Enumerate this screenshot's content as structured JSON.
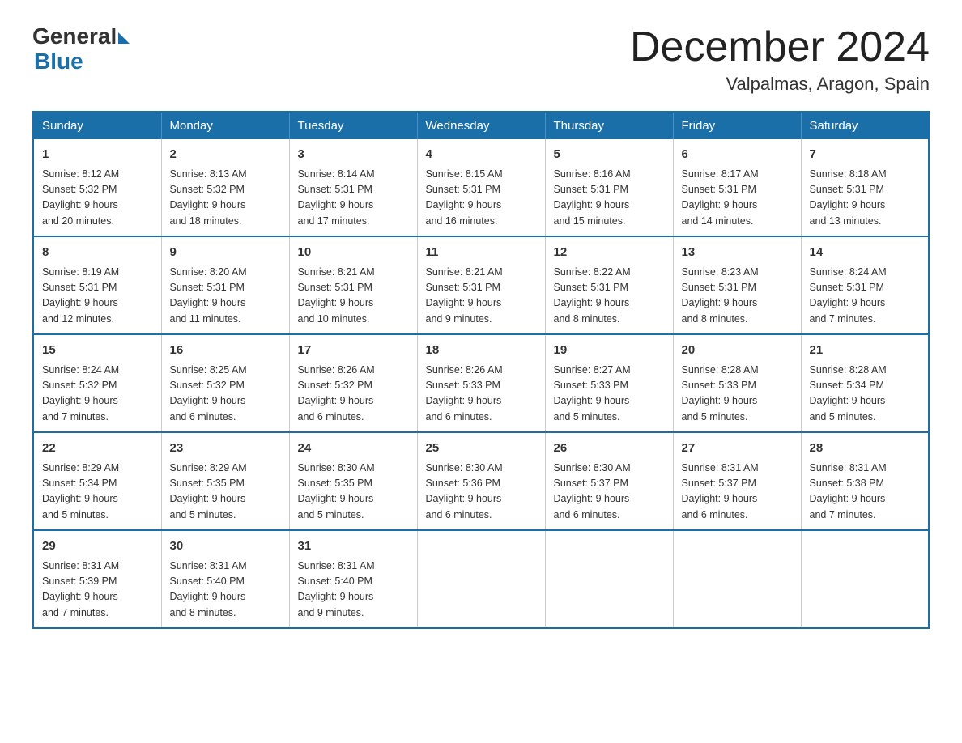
{
  "header": {
    "logo_general": "General",
    "logo_blue": "Blue",
    "month_title": "December 2024",
    "location": "Valpalmas, Aragon, Spain"
  },
  "weekdays": [
    "Sunday",
    "Monday",
    "Tuesday",
    "Wednesday",
    "Thursday",
    "Friday",
    "Saturday"
  ],
  "weeks": [
    [
      {
        "day": "1",
        "sunrise": "8:12 AM",
        "sunset": "5:32 PM",
        "daylight": "9 hours and 20 minutes."
      },
      {
        "day": "2",
        "sunrise": "8:13 AM",
        "sunset": "5:32 PM",
        "daylight": "9 hours and 18 minutes."
      },
      {
        "day": "3",
        "sunrise": "8:14 AM",
        "sunset": "5:31 PM",
        "daylight": "9 hours and 17 minutes."
      },
      {
        "day": "4",
        "sunrise": "8:15 AM",
        "sunset": "5:31 PM",
        "daylight": "9 hours and 16 minutes."
      },
      {
        "day": "5",
        "sunrise": "8:16 AM",
        "sunset": "5:31 PM",
        "daylight": "9 hours and 15 minutes."
      },
      {
        "day": "6",
        "sunrise": "8:17 AM",
        "sunset": "5:31 PM",
        "daylight": "9 hours and 14 minutes."
      },
      {
        "day": "7",
        "sunrise": "8:18 AM",
        "sunset": "5:31 PM",
        "daylight": "9 hours and 13 minutes."
      }
    ],
    [
      {
        "day": "8",
        "sunrise": "8:19 AM",
        "sunset": "5:31 PM",
        "daylight": "9 hours and 12 minutes."
      },
      {
        "day": "9",
        "sunrise": "8:20 AM",
        "sunset": "5:31 PM",
        "daylight": "9 hours and 11 minutes."
      },
      {
        "day": "10",
        "sunrise": "8:21 AM",
        "sunset": "5:31 PM",
        "daylight": "9 hours and 10 minutes."
      },
      {
        "day": "11",
        "sunrise": "8:21 AM",
        "sunset": "5:31 PM",
        "daylight": "9 hours and 9 minutes."
      },
      {
        "day": "12",
        "sunrise": "8:22 AM",
        "sunset": "5:31 PM",
        "daylight": "9 hours and 8 minutes."
      },
      {
        "day": "13",
        "sunrise": "8:23 AM",
        "sunset": "5:31 PM",
        "daylight": "9 hours and 8 minutes."
      },
      {
        "day": "14",
        "sunrise": "8:24 AM",
        "sunset": "5:31 PM",
        "daylight": "9 hours and 7 minutes."
      }
    ],
    [
      {
        "day": "15",
        "sunrise": "8:24 AM",
        "sunset": "5:32 PM",
        "daylight": "9 hours and 7 minutes."
      },
      {
        "day": "16",
        "sunrise": "8:25 AM",
        "sunset": "5:32 PM",
        "daylight": "9 hours and 6 minutes."
      },
      {
        "day": "17",
        "sunrise": "8:26 AM",
        "sunset": "5:32 PM",
        "daylight": "9 hours and 6 minutes."
      },
      {
        "day": "18",
        "sunrise": "8:26 AM",
        "sunset": "5:33 PM",
        "daylight": "9 hours and 6 minutes."
      },
      {
        "day": "19",
        "sunrise": "8:27 AM",
        "sunset": "5:33 PM",
        "daylight": "9 hours and 5 minutes."
      },
      {
        "day": "20",
        "sunrise": "8:28 AM",
        "sunset": "5:33 PM",
        "daylight": "9 hours and 5 minutes."
      },
      {
        "day": "21",
        "sunrise": "8:28 AM",
        "sunset": "5:34 PM",
        "daylight": "9 hours and 5 minutes."
      }
    ],
    [
      {
        "day": "22",
        "sunrise": "8:29 AM",
        "sunset": "5:34 PM",
        "daylight": "9 hours and 5 minutes."
      },
      {
        "day": "23",
        "sunrise": "8:29 AM",
        "sunset": "5:35 PM",
        "daylight": "9 hours and 5 minutes."
      },
      {
        "day": "24",
        "sunrise": "8:30 AM",
        "sunset": "5:35 PM",
        "daylight": "9 hours and 5 minutes."
      },
      {
        "day": "25",
        "sunrise": "8:30 AM",
        "sunset": "5:36 PM",
        "daylight": "9 hours and 6 minutes."
      },
      {
        "day": "26",
        "sunrise": "8:30 AM",
        "sunset": "5:37 PM",
        "daylight": "9 hours and 6 minutes."
      },
      {
        "day": "27",
        "sunrise": "8:31 AM",
        "sunset": "5:37 PM",
        "daylight": "9 hours and 6 minutes."
      },
      {
        "day": "28",
        "sunrise": "8:31 AM",
        "sunset": "5:38 PM",
        "daylight": "9 hours and 7 minutes."
      }
    ],
    [
      {
        "day": "29",
        "sunrise": "8:31 AM",
        "sunset": "5:39 PM",
        "daylight": "9 hours and 7 minutes."
      },
      {
        "day": "30",
        "sunrise": "8:31 AM",
        "sunset": "5:40 PM",
        "daylight": "9 hours and 8 minutes."
      },
      {
        "day": "31",
        "sunrise": "8:31 AM",
        "sunset": "5:40 PM",
        "daylight": "9 hours and 9 minutes."
      },
      {
        "day": "",
        "sunrise": "",
        "sunset": "",
        "daylight": ""
      },
      {
        "day": "",
        "sunrise": "",
        "sunset": "",
        "daylight": ""
      },
      {
        "day": "",
        "sunrise": "",
        "sunset": "",
        "daylight": ""
      },
      {
        "day": "",
        "sunrise": "",
        "sunset": "",
        "daylight": ""
      }
    ]
  ],
  "labels": {
    "sunrise_prefix": "Sunrise: ",
    "sunset_prefix": "Sunset: ",
    "daylight_prefix": "Daylight: "
  }
}
